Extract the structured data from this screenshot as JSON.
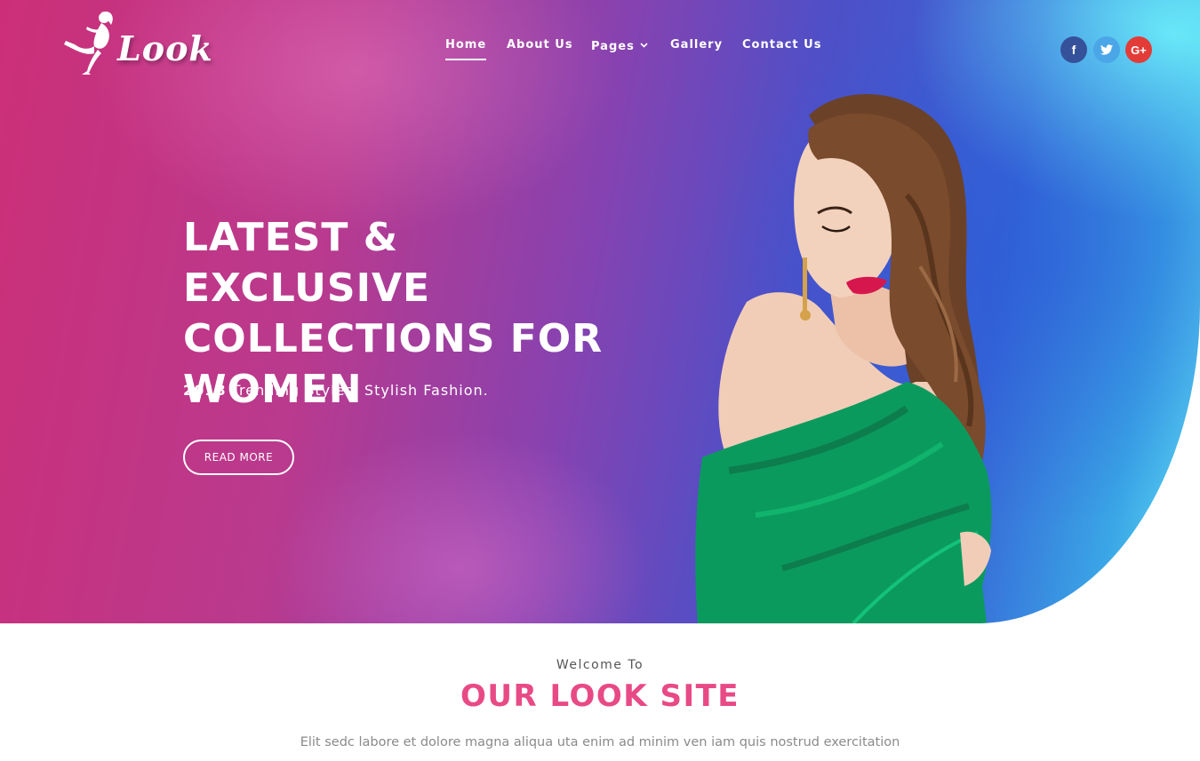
{
  "brand": {
    "logo_text": "Look",
    "logo_icon": "woman-silhouette-icon"
  },
  "nav": {
    "items": [
      {
        "label": "Home",
        "active": true
      },
      {
        "label": "About Us"
      },
      {
        "label": "Pages",
        "has_dropdown": true
      },
      {
        "label": "Gallery"
      },
      {
        "label": "Contact Us"
      }
    ]
  },
  "social": {
    "facebook": "f",
    "twitter_icon": "twitter-bird-icon",
    "google_plus": "G+"
  },
  "hero": {
    "title": "LATEST & EXCLUSIVE COLLECTIONS FOR WOMEN",
    "subtitle_year": "2018",
    "subtitle_rest": " Trending Styles, Stylish Fashion.",
    "button_label": "READ MORE"
  },
  "welcome": {
    "small": "Welcome To",
    "title": "OUR LOOK SITE",
    "text": "Elit sedc labore et dolore magna aliqua uta enim ad minim ven iam quis nostrud exercitation"
  },
  "colors": {
    "accent": "#e84a86",
    "facebook": "#35519a",
    "twitter": "#4ba6e8",
    "google_plus": "#e33c38"
  }
}
